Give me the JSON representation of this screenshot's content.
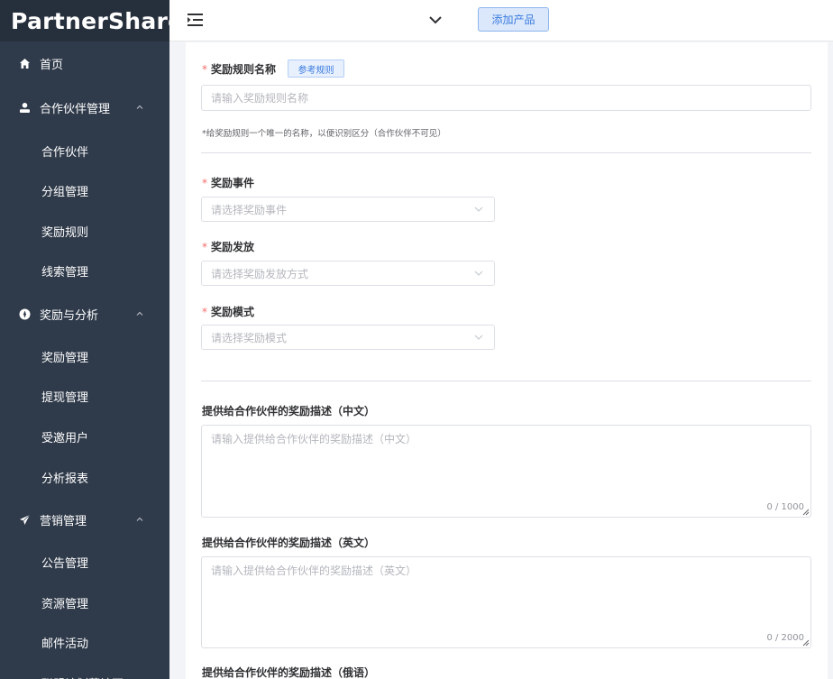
{
  "app": {
    "logo": "PartnerShare"
  },
  "header": {
    "add_product_label": "添加产品"
  },
  "sidebar": {
    "home": "首页",
    "partner_mgmt": {
      "label": "合作伙伴管理",
      "items": [
        "合作伙伴",
        "分组管理",
        "奖励规则",
        "线索管理"
      ]
    },
    "reward_analysis": {
      "label": "奖励与分析",
      "items": [
        "奖励管理",
        "提现管理",
        "受邀用户",
        "分析报表"
      ]
    },
    "marketing": {
      "label": "营销管理",
      "items": [
        "公告管理",
        "资源管理",
        "邮件活动",
        "联盟计划落地页"
      ]
    }
  },
  "form": {
    "rule_name": {
      "required_mark": "*",
      "label": "奖励规则名称",
      "ref_button": "参考规则",
      "placeholder": "请输入奖励规则名称",
      "hint": "*给奖励规则一个唯一的名称，以便识别区分（合作伙伴不可见）"
    },
    "reward_event": {
      "required_mark": "*",
      "label": "奖励事件",
      "placeholder": "请选择奖励事件"
    },
    "reward_payout": {
      "required_mark": "*",
      "label": "奖励发放",
      "placeholder": "请选择奖励发放方式"
    },
    "reward_mode": {
      "required_mark": "*",
      "label": "奖励模式",
      "placeholder": "请选择奖励模式"
    },
    "desc_zh": {
      "label": "提供给合作伙伴的奖励描述（中文）",
      "placeholder": "请输入提供给合作伙伴的奖励描述（中文）",
      "counter": "0 / 1000"
    },
    "desc_en": {
      "label": "提供给合作伙伴的奖励描述（英文）",
      "placeholder": "请输入提供给合作伙伴的奖励描述（英文）",
      "counter": "0 / 2000"
    },
    "desc_ru": {
      "label": "提供给合作伙伴的奖励描述（俄语）"
    }
  },
  "colors": {
    "sidebar_bg": "#2f3a4a",
    "logo_bg": "#262f3c",
    "required": "#f56c6c",
    "primary": "#3a7be0"
  },
  "icons": {
    "home": "home-icon",
    "partner": "user-icon",
    "reward": "compass-icon",
    "marketing": "paper-plane-icon",
    "menu_toggle": "hamburger-icon",
    "dropdown": "chevron-down-icon",
    "select_arrow": "chevron-down-icon",
    "resize": "resize-grip-icon"
  }
}
